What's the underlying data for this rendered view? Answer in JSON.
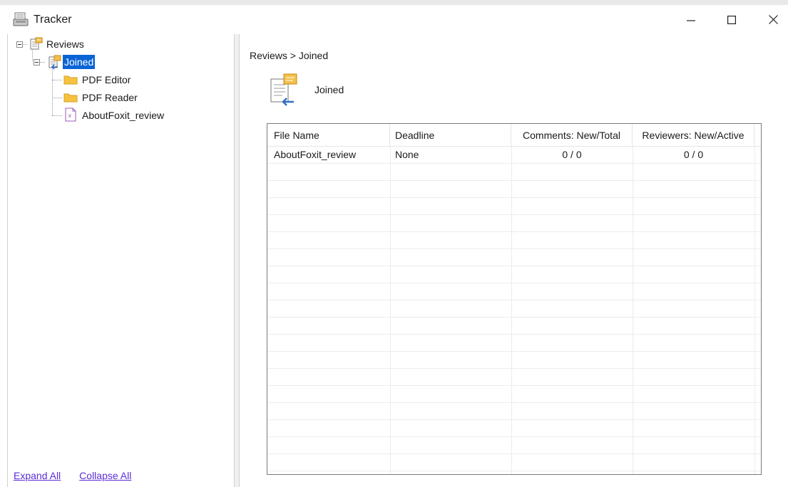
{
  "window": {
    "title": "Tracker",
    "icons": {
      "app": "tracker-app-icon",
      "minimize": "minimize-icon",
      "maximize": "maximize-icon",
      "close": "close-icon"
    }
  },
  "tree": {
    "root": {
      "label": "Reviews",
      "icon": "reviews-icon"
    },
    "joined": {
      "label": "Joined",
      "icon": "joined-review-icon",
      "selected": true
    },
    "children": [
      {
        "label": "PDF Editor",
        "icon": "folder-icon"
      },
      {
        "label": "PDF Reader",
        "icon": "folder-icon"
      },
      {
        "label": "AboutFoxit_review",
        "icon": "pdf-file-icon"
      }
    ]
  },
  "footer": {
    "expand_all": "Expand All",
    "collapse_all": "Collapse All"
  },
  "main": {
    "breadcrumb": "Reviews > Joined",
    "section_title": "Joined",
    "section_icon": "joined-review-icon"
  },
  "table": {
    "headers": [
      "File Name",
      "Deadline",
      "Comments: New/Total",
      "Reviewers: New/Active"
    ],
    "rows": [
      {
        "file_name": "AboutFoxit_review",
        "deadline": "None",
        "comments": "0 / 0",
        "reviewers": "0 / 0"
      }
    ]
  },
  "colors": {
    "selection": "#0a64d6",
    "link": "#5b2ed6",
    "folder": "#f5c242",
    "table_border": "#7a7a7a"
  }
}
